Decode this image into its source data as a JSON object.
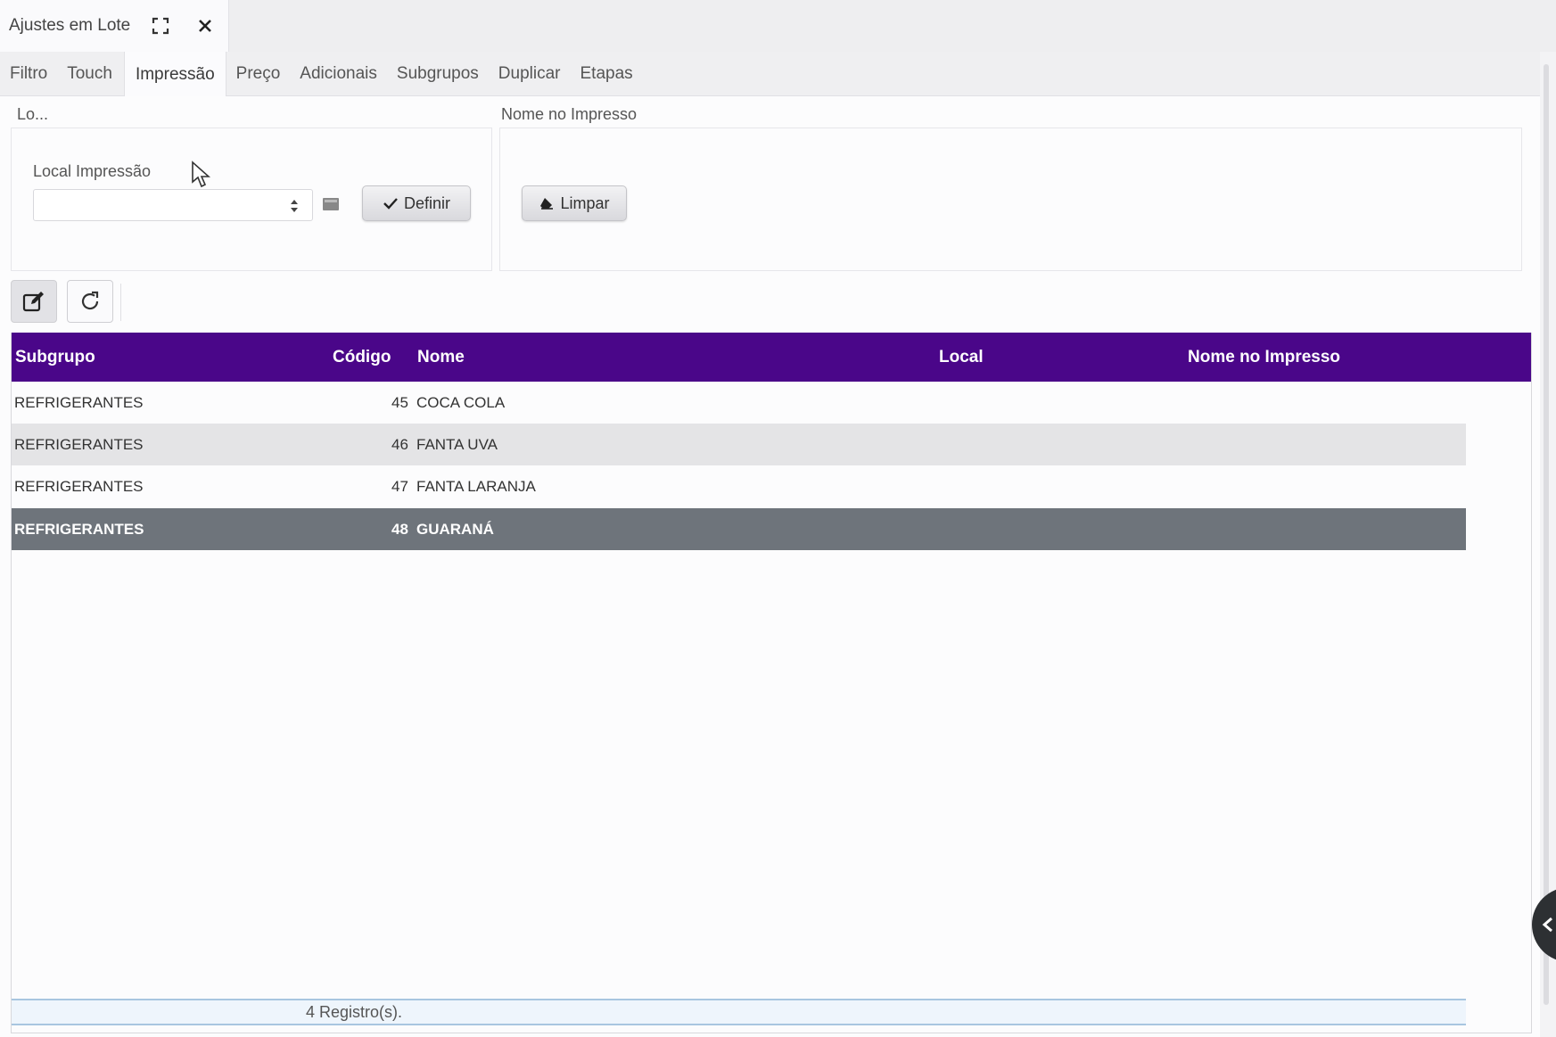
{
  "window": {
    "title": "Ajustes em Lote",
    "maximize_icon": "maximize-icon",
    "close_icon": "close-icon"
  },
  "tabs": [
    {
      "label": "Filtro",
      "active": false
    },
    {
      "label": "Touch",
      "active": false
    },
    {
      "label": "Impressão",
      "active": true
    },
    {
      "label": "Preço",
      "active": false
    },
    {
      "label": "Adicionais",
      "active": false
    },
    {
      "label": "Subgrupos",
      "active": false
    },
    {
      "label": "Duplicar",
      "active": false
    },
    {
      "label": "Etapas",
      "active": false
    }
  ],
  "local_panel": {
    "legend": "Lo...",
    "field_label": "Local Impressão",
    "select_value": "",
    "define_button": "Definir"
  },
  "name_panel": {
    "legend": "Nome no Impresso",
    "clear_button": "Limpar"
  },
  "toolbar": {
    "edit_icon": "edit-icon",
    "refresh_icon": "refresh-icon"
  },
  "grid": {
    "columns": [
      "Subgrupo",
      "Código",
      "Nome",
      "Local",
      "Nome no Impresso"
    ],
    "rows": [
      {
        "subgrupo": "REFRIGERANTES",
        "codigo": "45",
        "nome": "COCA COLA",
        "local": "",
        "nome_impresso": ""
      },
      {
        "subgrupo": "REFRIGERANTES",
        "codigo": "46",
        "nome": "FANTA UVA",
        "local": "",
        "nome_impresso": ""
      },
      {
        "subgrupo": "REFRIGERANTES",
        "codigo": "47",
        "nome": "FANTA LARANJA",
        "local": "",
        "nome_impresso": ""
      },
      {
        "subgrupo": "REFRIGERANTES",
        "codigo": "48",
        "nome": "GUARANÁ",
        "local": "",
        "nome_impresso": ""
      }
    ],
    "selected_row": 3,
    "footer": "4 Registro(s)."
  },
  "colors": {
    "header_bg": "#4a0689",
    "selected_row_bg": "#6e747b",
    "alt_row_bg": "#e4e4e6",
    "footer_bg": "#eef5fc"
  }
}
